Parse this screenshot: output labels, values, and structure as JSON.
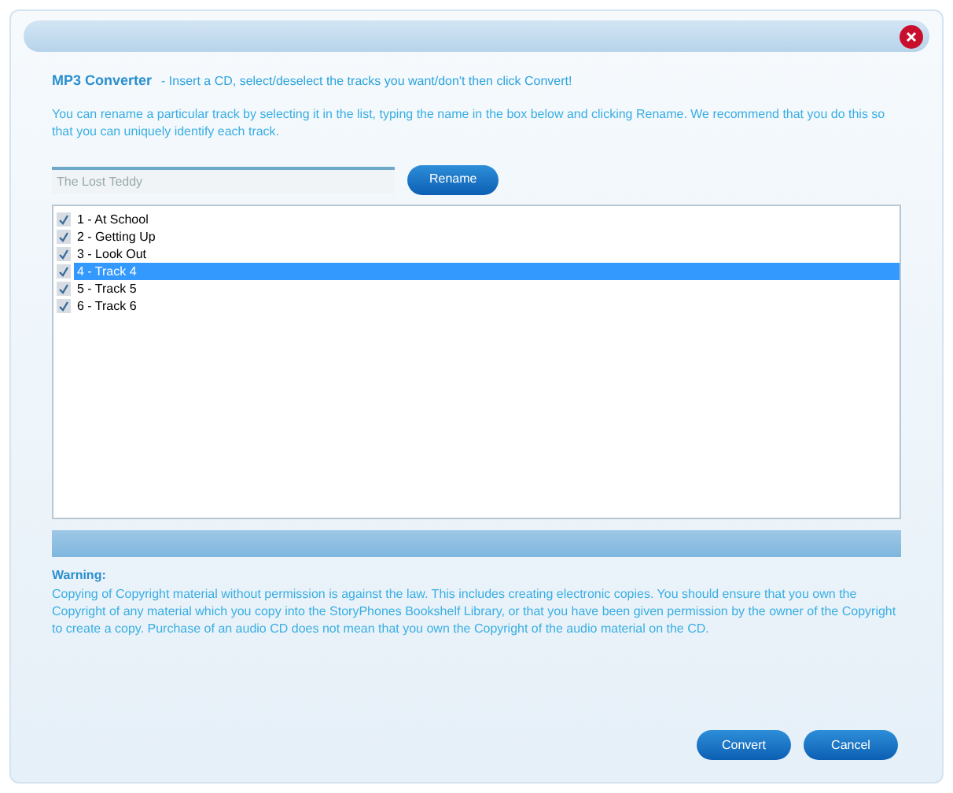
{
  "header": {
    "title": "MP3 Converter",
    "instruction": "- Insert a CD, select/deselect the tracks you want/don't then click Convert!"
  },
  "help_text": "You can rename a particular track by selecting it in the list, typing the name in the box below and clicking Rename. We recommend that you do this so that you can uniquely identify each track.",
  "rename_field": {
    "value": "The Lost Teddy"
  },
  "rename_button": "Rename",
  "tracks": [
    {
      "label": "1 - At School",
      "checked": true,
      "selected": false
    },
    {
      "label": "2 - Getting Up",
      "checked": true,
      "selected": false
    },
    {
      "label": "3 - Look Out",
      "checked": true,
      "selected": false
    },
    {
      "label": "4 - Track 4",
      "checked": true,
      "selected": true
    },
    {
      "label": "5 - Track 5",
      "checked": true,
      "selected": false
    },
    {
      "label": "6 - Track 6",
      "checked": true,
      "selected": false
    }
  ],
  "progress": {
    "level": 0
  },
  "warning": {
    "title": "Warning:",
    "text": "Copying of Copyright material without permission is against the law.  This includes creating electronic copies.  You should ensure that you own the Copyright of any material which you copy into the StoryPhones Bookshelf Library, or that you have been given permission by the owner of the Copyright to create a copy.  Purchase of an audio CD does not mean that you own the Copyright of the audio material on the CD."
  },
  "buttons": [
    "Convert",
    "Cancel"
  ]
}
